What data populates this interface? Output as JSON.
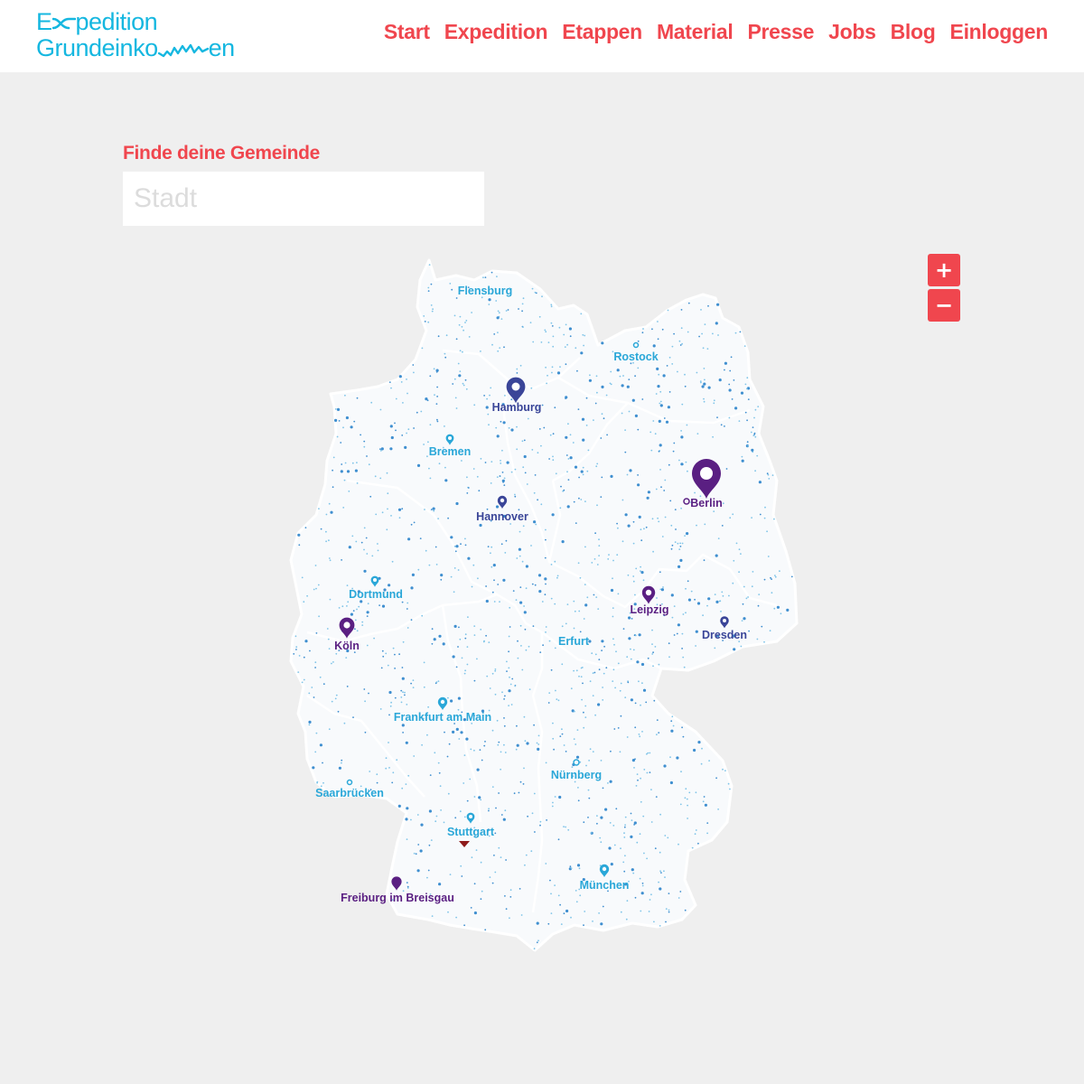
{
  "header": {
    "logo": {
      "line1_prefix": "E",
      "line1_suffix": "pedition",
      "line2_prefix": "Grundeinko",
      "line2_suffix": "en"
    },
    "nav": [
      {
        "label": "Start"
      },
      {
        "label": "Expedition"
      },
      {
        "label": "Etappen"
      },
      {
        "label": "Material"
      },
      {
        "label": "Presse"
      },
      {
        "label": "Jobs"
      },
      {
        "label": "Blog"
      },
      {
        "label": "Einloggen"
      }
    ]
  },
  "search": {
    "label": "Finde deine Gemeinde",
    "placeholder": "Stadt",
    "value": ""
  },
  "zoom": {
    "in_label": "+",
    "out_label": "−"
  },
  "map": {
    "colors": {
      "land": "#ffffff",
      "border": "#ffffff",
      "dot_light": "#7fc4e8",
      "dot_mid": "#3f8fd0",
      "marker_blue": "#2aa7d8",
      "marker_navy": "#3a4598",
      "marker_purple": "#5a1f82",
      "marker_red": "#8e1b1b"
    },
    "cities": [
      {
        "name": "Flensburg",
        "color": "#2aa7d8"
      },
      {
        "name": "Rostock",
        "color": "#2aa7d8"
      },
      {
        "name": "Hamburg",
        "color": "#3a4598"
      },
      {
        "name": "Bremen",
        "color": "#2aa7d8"
      },
      {
        "name": "Berlin",
        "color": "#5a1f82"
      },
      {
        "name": "Hannover",
        "color": "#3a4598"
      },
      {
        "name": "Dortmund",
        "color": "#2aa7d8"
      },
      {
        "name": "Leipzig",
        "color": "#5a1f82"
      },
      {
        "name": "Köln",
        "color": "#5a1f82"
      },
      {
        "name": "Dresden",
        "color": "#3a4598"
      },
      {
        "name": "Erfurt",
        "color": "#2aa7d8"
      },
      {
        "name": "Frankfurt am Main",
        "color": "#2aa7d8"
      },
      {
        "name": "Nürnberg",
        "color": "#2aa7d8"
      },
      {
        "name": "Saarbrücken",
        "color": "#2aa7d8"
      },
      {
        "name": "Stuttgart",
        "color": "#2aa7d8"
      },
      {
        "name": "München",
        "color": "#2aa7d8"
      },
      {
        "name": "Freiburg im Breisgau",
        "color": "#5a1f82"
      }
    ]
  }
}
